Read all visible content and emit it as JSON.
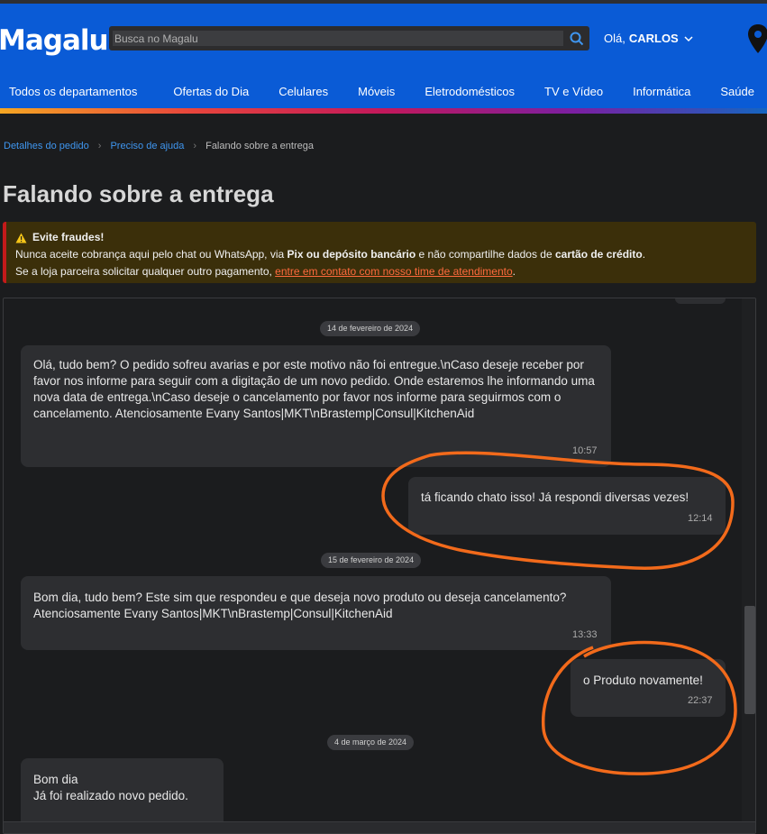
{
  "header": {
    "logo": "Magalu",
    "search_placeholder": "Busca no Magalu",
    "greeting_prefix": "Olá,",
    "greeting_name": "CARLOS",
    "nav": {
      "all_departments": "Todos os departamentos",
      "items": [
        "Ofertas do Dia",
        "Celulares",
        "Móveis",
        "Eletrodomésticos",
        "TV e Vídeo",
        "Informática",
        "Saúde"
      ]
    }
  },
  "breadcrumb": {
    "items": [
      "Detalhes do pedido",
      "Preciso de ajuda"
    ],
    "current": "Falando sobre a entrega"
  },
  "page_title": "Falando sobre a entrega",
  "warning": {
    "title": "Evite fraudes!",
    "line1_a": "Nunca aceite cobrança aqui pelo chat ou WhatsApp, via ",
    "line1_b": "Pix ou depósito bancário",
    "line1_c": " e não compartilhe dados de ",
    "line1_d": "cartão de crédito",
    "line1_e": ".",
    "line2_a": "Se a loja parceira solicitar qualquer outro pagamento, ",
    "line2_link": "entre em contato com nosso time de atendimento",
    "line2_b": "."
  },
  "chat": {
    "dates": [
      "14 de fevereiro de 2024",
      "15 de fevereiro de 2024",
      "4 de março de 2024"
    ],
    "messages": [
      {
        "from": "store",
        "text": "Olá, tudo bem? O pedido sofreu avarias e por este motivo não foi entregue.\\nCaso deseje receber por favor nos informe para seguir com a digitação de um novo pedido. Onde estaremos lhe informando uma nova data de entrega.\\nCaso deseje o cancelamento por favor nos informe para seguirmos com o cancelamento. Atenciosamente Evany Santos|MKT\\nBrastemp|Consul|KitchenAid",
        "time": "10:57"
      },
      {
        "from": "user",
        "text": "tá ficando chato isso! Já respondi diversas vezes!",
        "time": "12:14"
      },
      {
        "from": "store",
        "text": "Bom dia, tudo bem? Este sim que respondeu e que deseja novo produto ou deseja cancelamento? Atenciosamente Evany Santos|MKT\\nBrastemp|Consul|KitchenAid",
        "time": "13:33"
      },
      {
        "from": "user",
        "text": "o Produto novamente!",
        "time": "22:37"
      },
      {
        "from": "store",
        "text": "Bom dia\nJá foi realizado novo pedido.",
        "time": ""
      }
    ]
  },
  "colors": {
    "header_blue": "#0a5bd6",
    "link_blue": "#3f96f0",
    "warning_bg": "#3b2f0a",
    "warning_border": "#c41a1a",
    "annotation_orange": "#f26a1b"
  }
}
